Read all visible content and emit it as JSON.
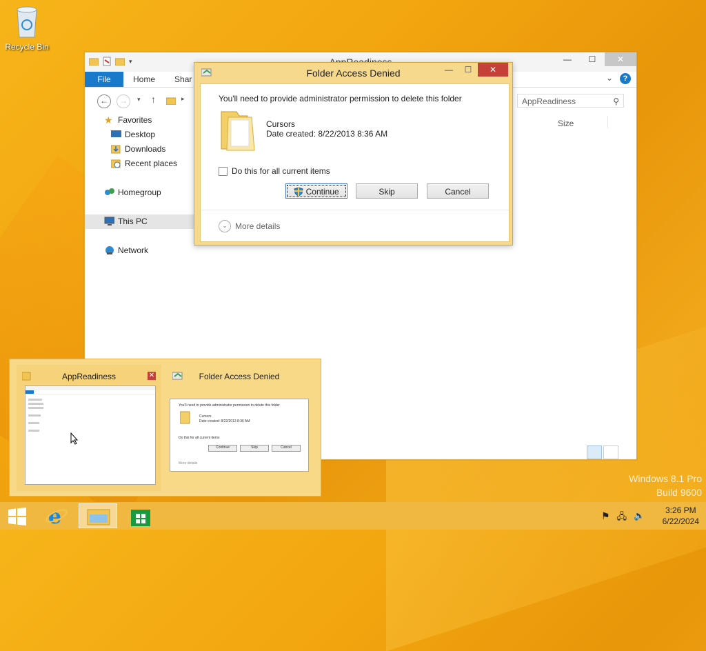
{
  "desktop": {
    "recycle_bin_label": "Recycle Bin"
  },
  "explorer": {
    "title": "AppReadiness",
    "tabs": {
      "file": "File",
      "home": "Home",
      "share": "Shar"
    },
    "search_placeholder": "AppReadiness",
    "column_size": "Size",
    "nav": {
      "favorites": "Favorites",
      "desktop": "Desktop",
      "downloads": "Downloads",
      "recent": "Recent places",
      "homegroup": "Homegroup",
      "thispc": "This PC",
      "network": "Network"
    }
  },
  "dialog": {
    "title": "Folder Access Denied",
    "message": "You'll need to provide administrator permission to delete this folder",
    "file_name": "Cursors",
    "file_date": "Date created: 8/22/2013 8:36 AM",
    "checkbox_label": "Do this for all current items",
    "btn_continue": "Continue",
    "btn_skip": "Skip",
    "btn_cancel": "Cancel",
    "more_details": "More details"
  },
  "preview": {
    "thumb1_title": "AppReadiness",
    "thumb2_title": "Folder Access Denied",
    "thumb2": {
      "message": "You'll need to provide administrator permission to delete this folder",
      "file_name": "Cursors",
      "file_date": "Date created: 8/22/2013 8:36 AM",
      "checkbox_label": "Do this for all current items",
      "btn_continue": "Continue",
      "btn_skip": "Skip",
      "btn_cancel": "Cancel",
      "more_details": "More details"
    }
  },
  "watermark": {
    "line1": "Windows 8.1 Pro",
    "line2": "Build 9600"
  },
  "tray": {
    "time": "3:26 PM",
    "date": "6/22/2024"
  },
  "colors": {
    "accent": "#1979ca",
    "dialog_frame": "#f6d98d",
    "close_red": "#c6403a",
    "taskbar": "#f0b840"
  }
}
